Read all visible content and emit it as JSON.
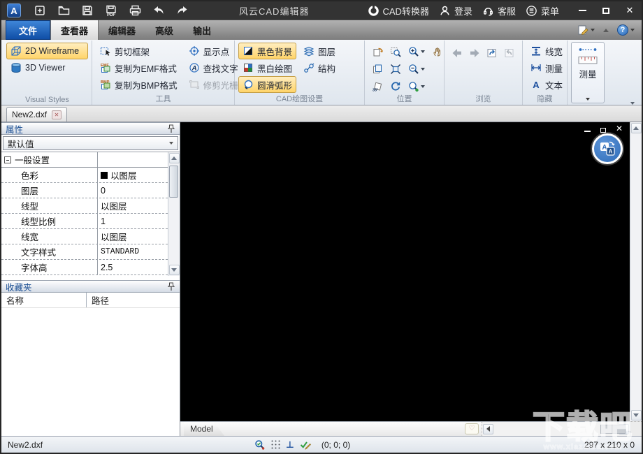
{
  "colors": {
    "accent_blue": "#2e6fc0",
    "highlight_orange": "#ffd469",
    "highlight_border": "#c49e45",
    "titlebar_bg": "#333333",
    "canvas_bg": "#000000",
    "file_tab_blue": "#0f4ea6"
  },
  "titlebar": {
    "title": "风云CAD编辑器",
    "converter": "CAD转换器",
    "login": "登录",
    "support": "客服",
    "menu": "菜单"
  },
  "tabs": {
    "file": "文件",
    "viewer": "查看器",
    "editor": "编辑器",
    "advanced": "高级",
    "output": "输出"
  },
  "ribbon": {
    "visual_styles": {
      "label": "Visual Styles",
      "wireframe": "2D Wireframe",
      "viewer3d": "3D Viewer"
    },
    "tools": {
      "label": "工具",
      "clip_frame": "剪切框架",
      "copy_emf": "复制为EMF格式",
      "copy_bmp": "复制为BMP格式",
      "show_points": "显示点",
      "find_text": "查找文字",
      "trim_raster": "修剪光栅",
      "emf_tag": "EMF",
      "bmp_tag": "BMP"
    },
    "cad_settings": {
      "label": "CAD绘图设置",
      "black_bg": "黑色背景",
      "bw_drawing": "黑白绘图",
      "smooth_arc": "圆滑弧形",
      "layers": "图层",
      "structure": "结构"
    },
    "position": {
      "label": "位置"
    },
    "browse": {
      "label": "浏览"
    },
    "hide": {
      "label": "隐藏",
      "line_width": "线宽",
      "measure": "测量",
      "text": "文本",
      "text_glyph": "A"
    },
    "measure_panel": {
      "label": "测量"
    }
  },
  "document": {
    "tab": "New2.dxf"
  },
  "properties": {
    "title": "属性",
    "preset": "默认值",
    "group": "一般设置",
    "rows": [
      {
        "label": "色彩",
        "value": "以图层"
      },
      {
        "label": "图层",
        "value": "0"
      },
      {
        "label": "线型",
        "value": "以图层"
      },
      {
        "label": "线型比例",
        "value": "1"
      },
      {
        "label": "线宽",
        "value": "以图层"
      },
      {
        "label": "文字样式",
        "value": "STANDARD"
      },
      {
        "label": "字体高",
        "value": "2.5"
      }
    ]
  },
  "favorites": {
    "title": "收藏夹",
    "col_name": "名称",
    "col_path": "路径"
  },
  "canvas": {
    "model_tab": "Model"
  },
  "statusbar": {
    "filename": "New2.dxf",
    "ortho_glyph": "⊥",
    "coords": "(0; 0; 0)",
    "size": "297 x 210 x 0"
  },
  "watermark": {
    "title": "下载吧",
    "url": "www.xiazaiba.com"
  }
}
